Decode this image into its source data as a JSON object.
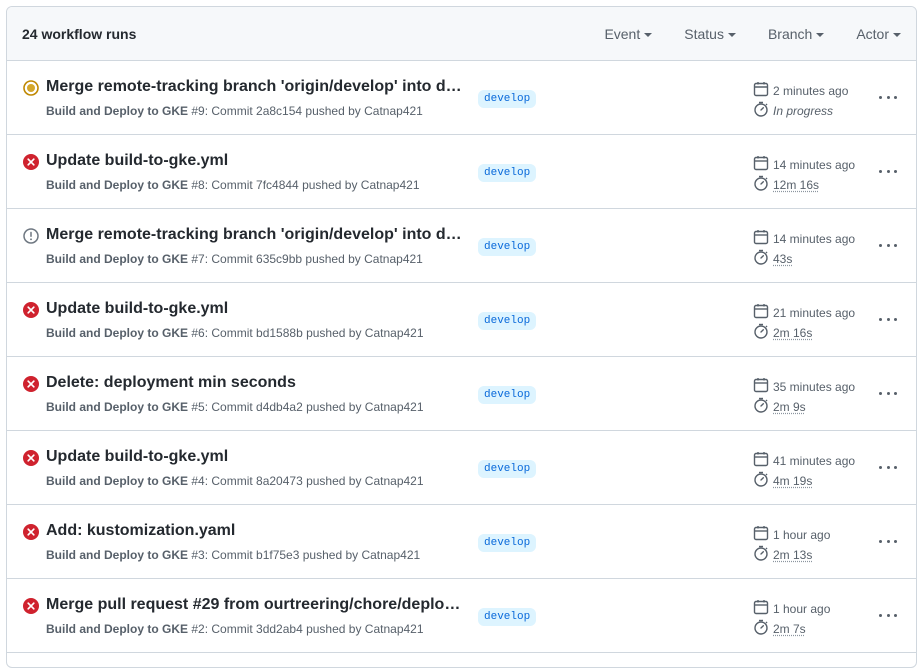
{
  "header": {
    "count_label": "24 workflow runs",
    "filters": [
      {
        "label": "Event"
      },
      {
        "label": "Status"
      },
      {
        "label": "Branch"
      },
      {
        "label": "Actor"
      }
    ]
  },
  "runs": [
    {
      "status": "in-progress",
      "title": "Merge remote-tracking branch 'origin/develop' into de…",
      "workflow": "Build and Deploy to GKE",
      "detail": " #9: Commit 2a8c154 pushed by Catnap421",
      "branch": "develop",
      "time": "2 minutes ago",
      "duration": "In progress"
    },
    {
      "status": "failure",
      "title": "Update build-to-gke.yml",
      "workflow": "Build and Deploy to GKE",
      "detail": " #8: Commit 7fc4844 pushed by Catnap421",
      "branch": "develop",
      "time": "14 minutes ago",
      "duration": "12m 16s"
    },
    {
      "status": "cancelled",
      "title": "Merge remote-tracking branch 'origin/develop' into de…",
      "workflow": "Build and Deploy to GKE",
      "detail": " #7: Commit 635c9bb pushed by Catnap421",
      "branch": "develop",
      "time": "14 minutes ago",
      "duration": "43s"
    },
    {
      "status": "failure",
      "title": "Update build-to-gke.yml",
      "workflow": "Build and Deploy to GKE",
      "detail": " #6: Commit bd1588b pushed by Catnap421",
      "branch": "develop",
      "time": "21 minutes ago",
      "duration": "2m 16s"
    },
    {
      "status": "failure",
      "title": "Delete: deployment min seconds",
      "workflow": "Build and Deploy to GKE",
      "detail": " #5: Commit d4db4a2 pushed by Catnap421",
      "branch": "develop",
      "time": "35 minutes ago",
      "duration": "2m 9s"
    },
    {
      "status": "failure",
      "title": "Update build-to-gke.yml",
      "workflow": "Build and Deploy to GKE",
      "detail": " #4: Commit 8a20473 pushed by Catnap421",
      "branch": "develop",
      "time": "41 minutes ago",
      "duration": "4m 19s"
    },
    {
      "status": "failure",
      "title": "Add: kustomization.yaml",
      "workflow": "Build and Deploy to GKE",
      "detail": " #3: Commit b1f75e3 pushed by Catnap421",
      "branch": "develop",
      "time": "1 hour ago",
      "duration": "2m 13s"
    },
    {
      "status": "failure",
      "title": "Merge pull request #29 from ourtreering/chore/deploy…",
      "workflow": "Build and Deploy to GKE",
      "detail": " #2: Commit 3dd2ab4 pushed by Catnap421",
      "branch": "develop",
      "time": "1 hour ago",
      "duration": "2m 7s"
    }
  ],
  "colors": {
    "failure": "#cf222e",
    "in_progress": "#bf8700",
    "neutral": "#6e7781",
    "branch_bg": "#ddf4ff",
    "branch_fg": "#0969da"
  }
}
